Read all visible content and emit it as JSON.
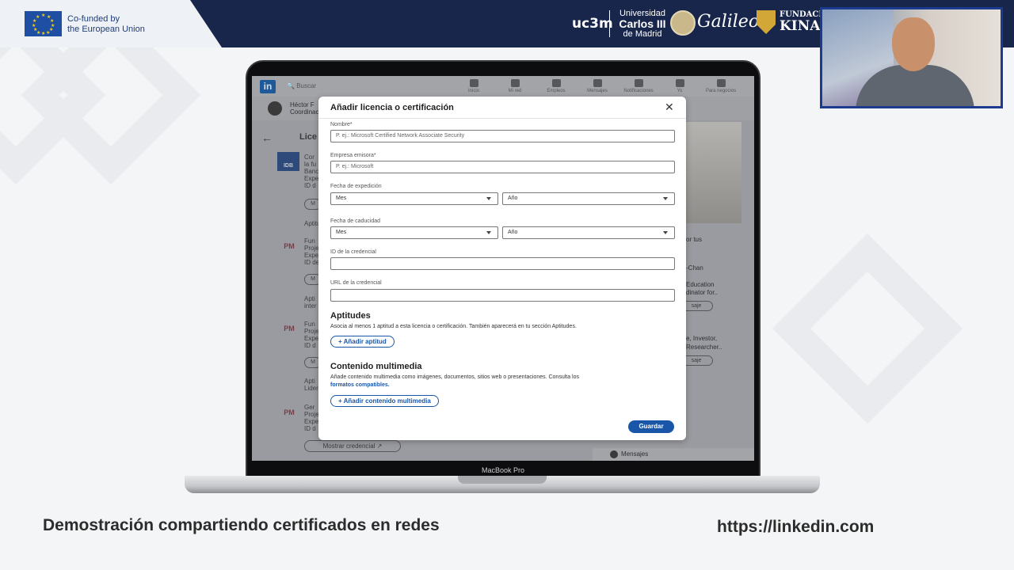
{
  "banner": {
    "eu_text_line1": "Co-funded by",
    "eu_text_line2": "the European Union",
    "uc3m": "uc3m",
    "uni_line1": "Universidad",
    "uni_line2": "Carlos III",
    "uni_line3": "de Madrid",
    "galileo": "Galileo",
    "kinal_line1": "FUNDACIÓ",
    "kinal_line2": "KINAL"
  },
  "linkedin_bg": {
    "search_placeholder": "Buscar",
    "nav_items": [
      "Inicio",
      "Mi red",
      "Empleos",
      "Mensajes",
      "Notificaciones",
      "Yo",
      "Para negocios"
    ],
    "profile_name": "Héctor F",
    "profile_role": "Coordinac",
    "licenses_title": "Lice",
    "entries": [
      {
        "logo": "IDB",
        "title": "Cor",
        "line2": "la fu",
        "line3": "Banc",
        "line4": "Expe",
        "line5": "ID d"
      },
      {
        "logo": "PM",
        "title": "Fun",
        "line2": "Proje",
        "line3": "Expe",
        "line4": "ID de"
      },
      {
        "logo": "PM",
        "title": "Fun",
        "line2": "Proje",
        "line3": "Expe",
        "line4": "ID d"
      },
      {
        "logo": "PM",
        "title": "Ger",
        "line2": "Proje",
        "line3": "Expe",
        "line4": "ID d"
      }
    ],
    "aptitudes_labels": [
      "Aptitu",
      "Apti",
      "Apti"
    ],
    "aptitudes_sub": [
      "inter",
      "Lider"
    ],
    "pill_label": "M",
    "show_credential": "Mostrar credencial",
    "right_texts": [
      "or tus",
      "-Chan",
      "Education",
      "dinator for..",
      "e, Investor,",
      "Researcher.."
    ],
    "right_buttons": [
      "saje",
      "saje"
    ],
    "messages": "Mensajes"
  },
  "modal": {
    "title": "Añadir licencia o certificación",
    "close_label": "✕",
    "nombre_label": "Nombre*",
    "nombre_placeholder": "P. ej.: Microsoft Certified Network Associate Security",
    "empresa_label": "Empresa emisora*",
    "empresa_placeholder": "P. ej.: Microsoft",
    "expedicion_label": "Fecha de expedición",
    "expedicion_mes": "Mes",
    "expedicion_anio": "Año",
    "caducidad_label": "Fecha de caducidad",
    "caducidad_mes": "Mes",
    "caducidad_anio": "Año",
    "id_label": "ID de la credencial",
    "id_value": "",
    "url_label": "URL de la credencial",
    "url_value": "",
    "aptitudes_heading": "Aptitudes",
    "aptitudes_desc": "Asocia al menos 1 aptitud a esta licencia o certificación. También aparecerá en tu sección Aptitudes.",
    "add_aptitud": "+ Añadir aptitud",
    "multimedia_heading": "Contenido multimedia",
    "multimedia_desc": "Añade contenido multimedia como imágenes, documentos, sitios web o presentaciones. Consulta los",
    "multimedia_link": "formatos compatibles.",
    "add_multimedia": "+ Añadir contenido multimedia",
    "save": "Guardar"
  },
  "device_label": "MacBook Pro",
  "captions": {
    "left": "Demostración compartiendo certificados en redes",
    "right": "https://linkedin.com"
  },
  "colors": {
    "banner": "#17264a",
    "linkedin_blue": "#1a56a8",
    "webcam_border": "#1b3b8f"
  }
}
